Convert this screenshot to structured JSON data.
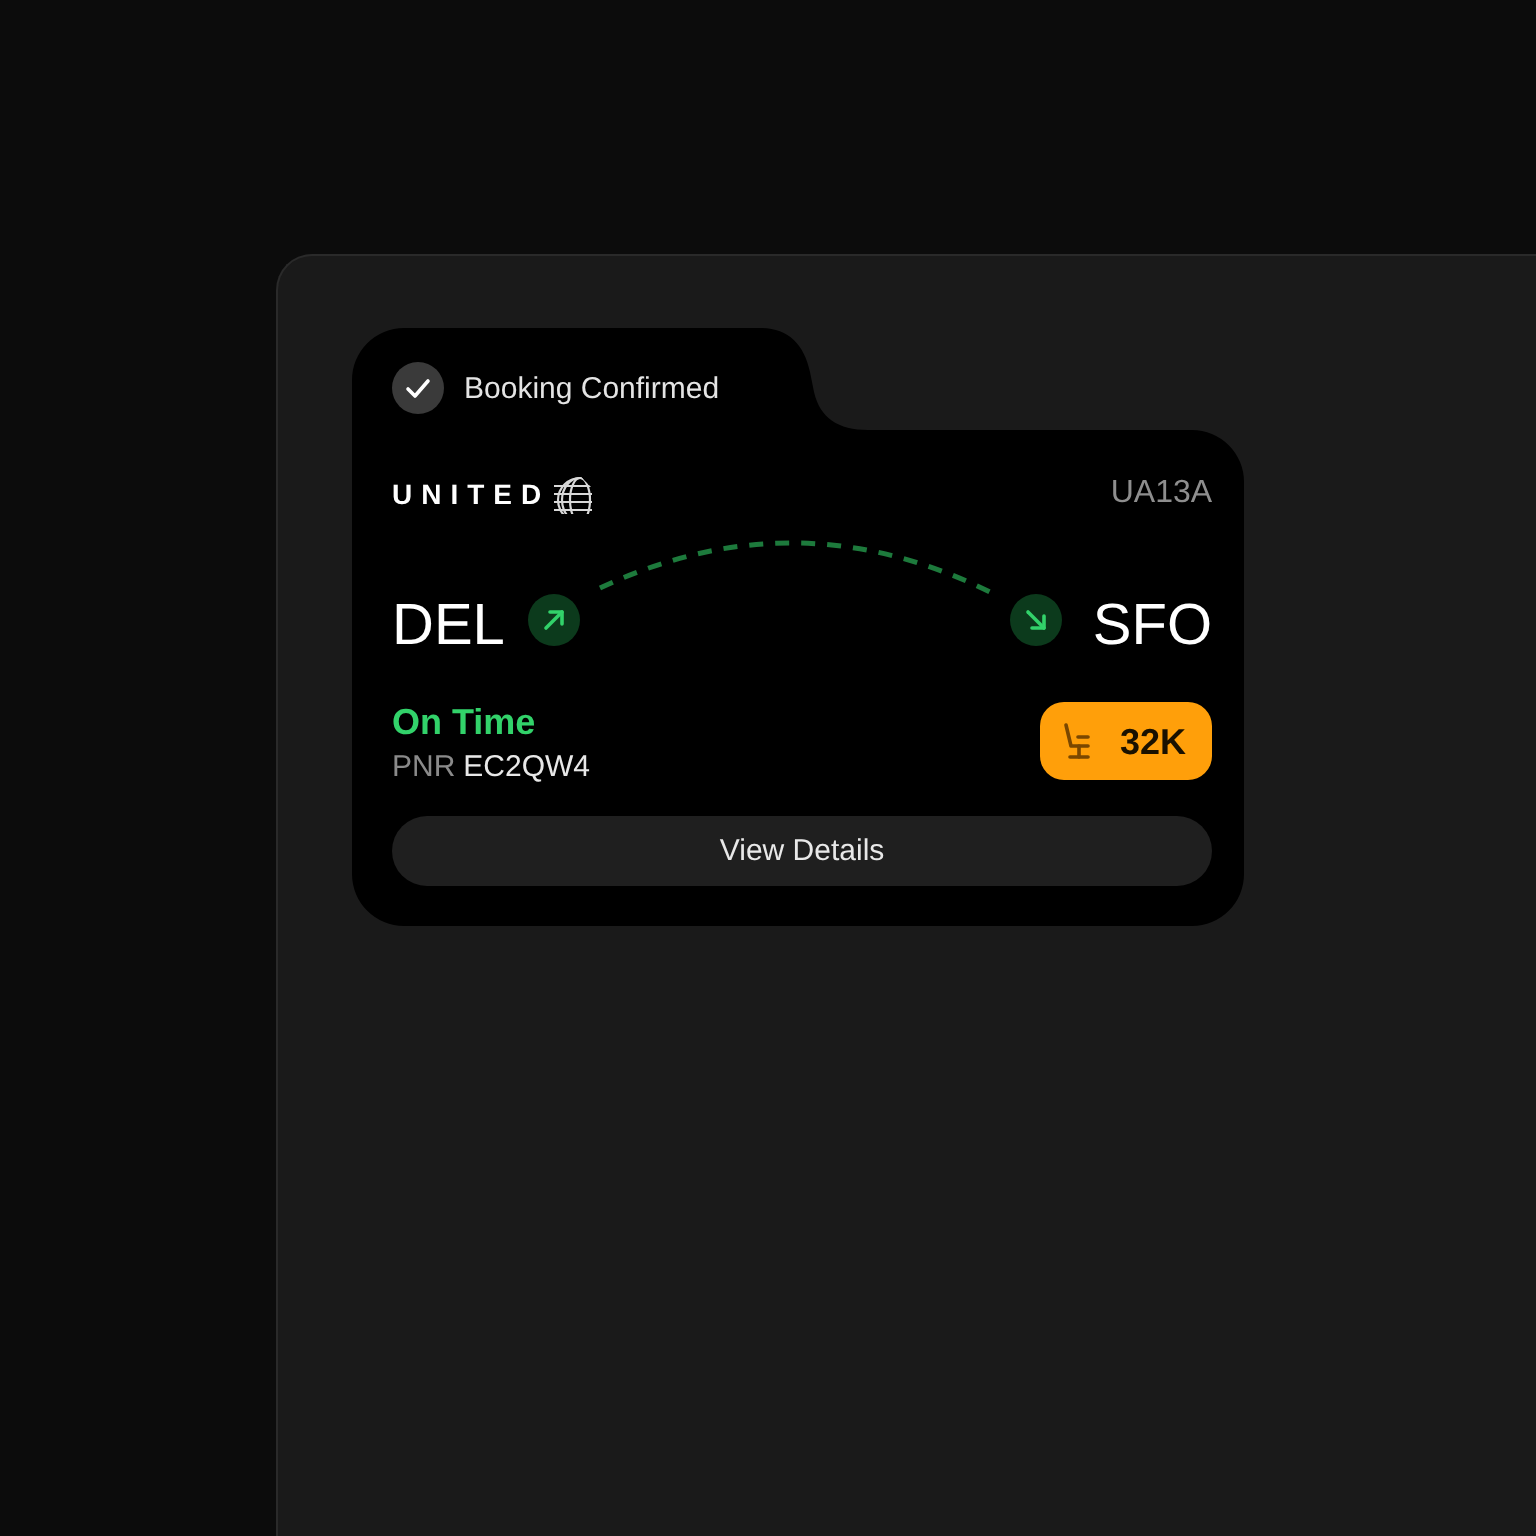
{
  "confirmation": {
    "label": "Booking Confirmed"
  },
  "flight": {
    "airline": "UNITED",
    "number": "UA13A",
    "origin": "DEL",
    "destination": "SFO"
  },
  "details": {
    "status": "On Time",
    "pnr_label": "PNR",
    "pnr": "EC2QW4",
    "seat": "32K"
  },
  "button": {
    "label": "View Details"
  }
}
